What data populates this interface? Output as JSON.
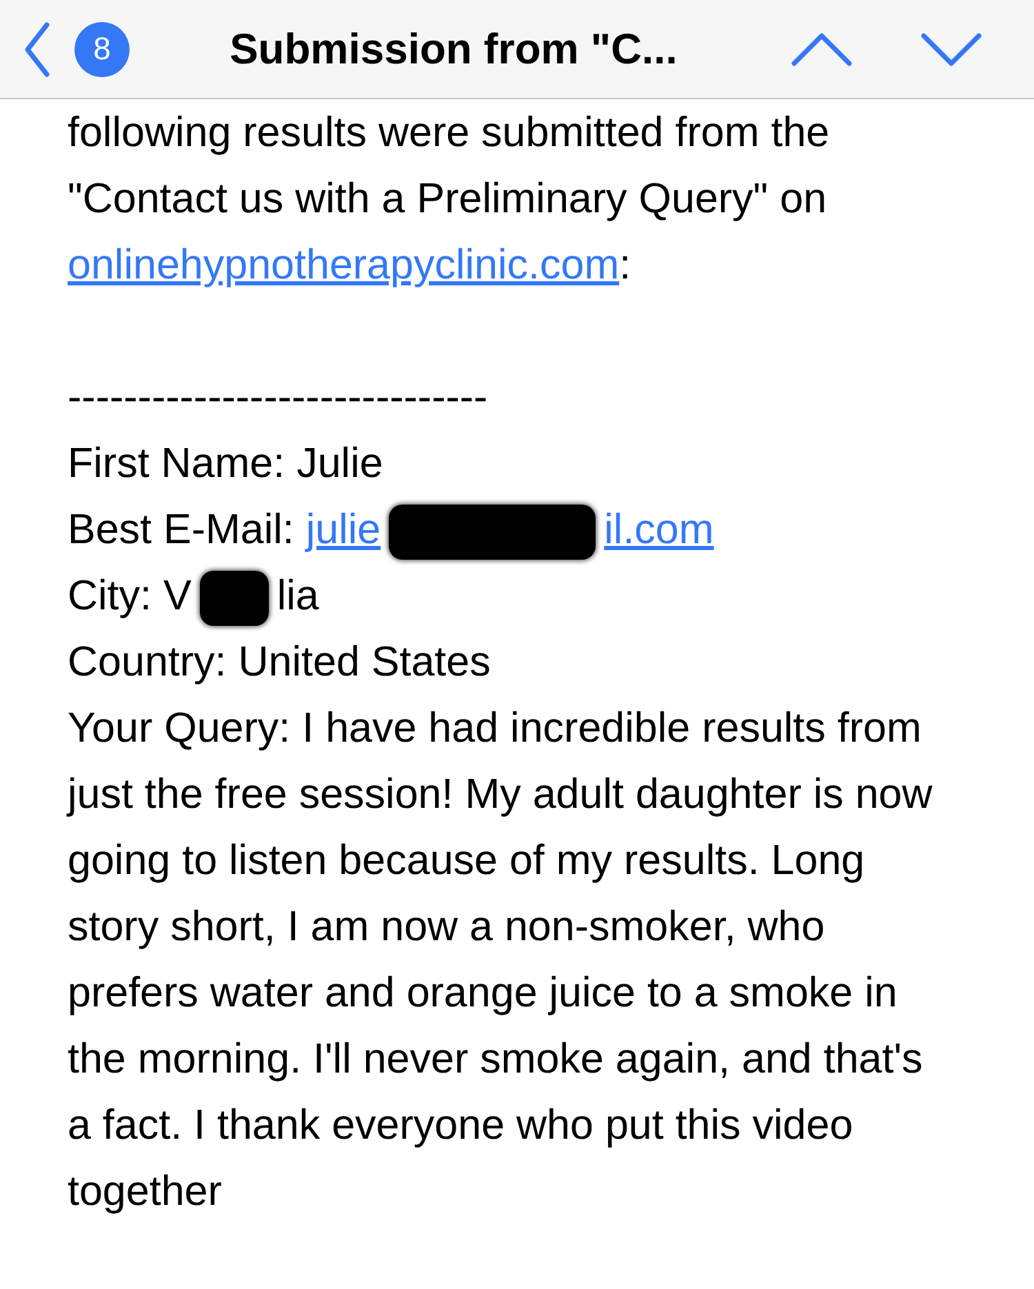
{
  "header": {
    "badge": "8",
    "title": "Submission from \"C..."
  },
  "intro": {
    "text": "following results were submitted from the \"Contact us with a Preliminary Query\" on ",
    "link": "onlinehypnotherapyclinic.com",
    "after": ":"
  },
  "divider": "------------------------------",
  "fields": [
    {
      "label": "First Name:",
      "parts": [
        {
          "kind": "text",
          "text": "Julie"
        }
      ]
    },
    {
      "label": "Best E-Mail:",
      "parts": [
        {
          "kind": "link",
          "text": "julie"
        },
        {
          "kind": "redaction"
        },
        {
          "kind": "link",
          "text": "il.com"
        }
      ]
    },
    {
      "label": "City:",
      "parts": [
        {
          "kind": "text",
          "text": "V"
        },
        {
          "kind": "redaction"
        },
        {
          "kind": "text",
          "text": "lia"
        }
      ]
    },
    {
      "label": "Country:",
      "parts": [
        {
          "kind": "text",
          "text": "United States"
        }
      ]
    },
    {
      "label": "Your Query:",
      "parts": [
        {
          "kind": "text",
          "text": "I have had incredible results from just the free session! My adult daughter is now going to listen because of my results. Long story short, I am now a non-smoker, who prefers water and orange juice to a smoke in the morning. I'll never smoke again, and that's a fact. I thank everyone who put this video together"
        }
      ]
    }
  ]
}
